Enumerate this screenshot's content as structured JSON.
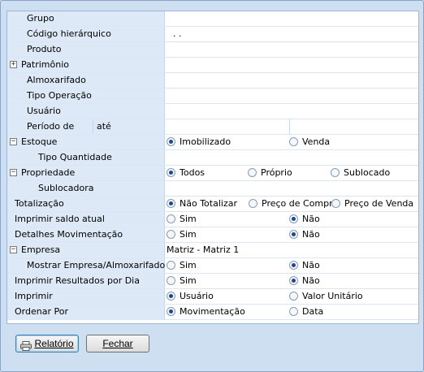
{
  "rows": {
    "grupo": "Grupo",
    "codigo": "Código hierárquico",
    "codigo_value": ". .",
    "produto": "Produto",
    "patrimonio": "Patrimônio",
    "almoxarifado": "Almoxarifado",
    "tipo_operacao": "Tipo Operação",
    "usuario": "Usuário",
    "periodo": "Período de",
    "periodo_ate": "até",
    "estoque": "Estoque",
    "estoque_opt1": "Imobilizado",
    "estoque_opt2": "Venda",
    "tipo_quantidade": "Tipo Quantidade",
    "propriedade": "Propriedade",
    "prop_opt1": "Todos",
    "prop_opt2": "Próprio",
    "prop_opt3": "Sublocado",
    "sublocadora": "Sublocadora",
    "totalizacao": "Totalização",
    "tot_opt1": "Não Totalizar",
    "tot_opt2": "Preço de Compra",
    "tot_opt3": "Preço de Venda",
    "imprimir_saldo": "Imprimir saldo atual",
    "detalhes_mov": "Detalhes Movimentação",
    "empresa": "Empresa",
    "empresa_value": "Matriz - Matriz 1",
    "mostrar_empresa": "Mostrar Empresa/Almoxarifado",
    "imprimir_resultados": "Imprimir Resultados por Dia",
    "imprimir": "Imprimir",
    "imp_opt1": "Usuário",
    "imp_opt2": "Valor Unitário",
    "ordenar": "Ordenar Por",
    "ord_opt1": "Movimentação",
    "ord_opt2": "Data",
    "sim": "Sim",
    "nao": "Não"
  },
  "buttons": {
    "relatorio": "Relatório",
    "fechar": "Fechar"
  }
}
